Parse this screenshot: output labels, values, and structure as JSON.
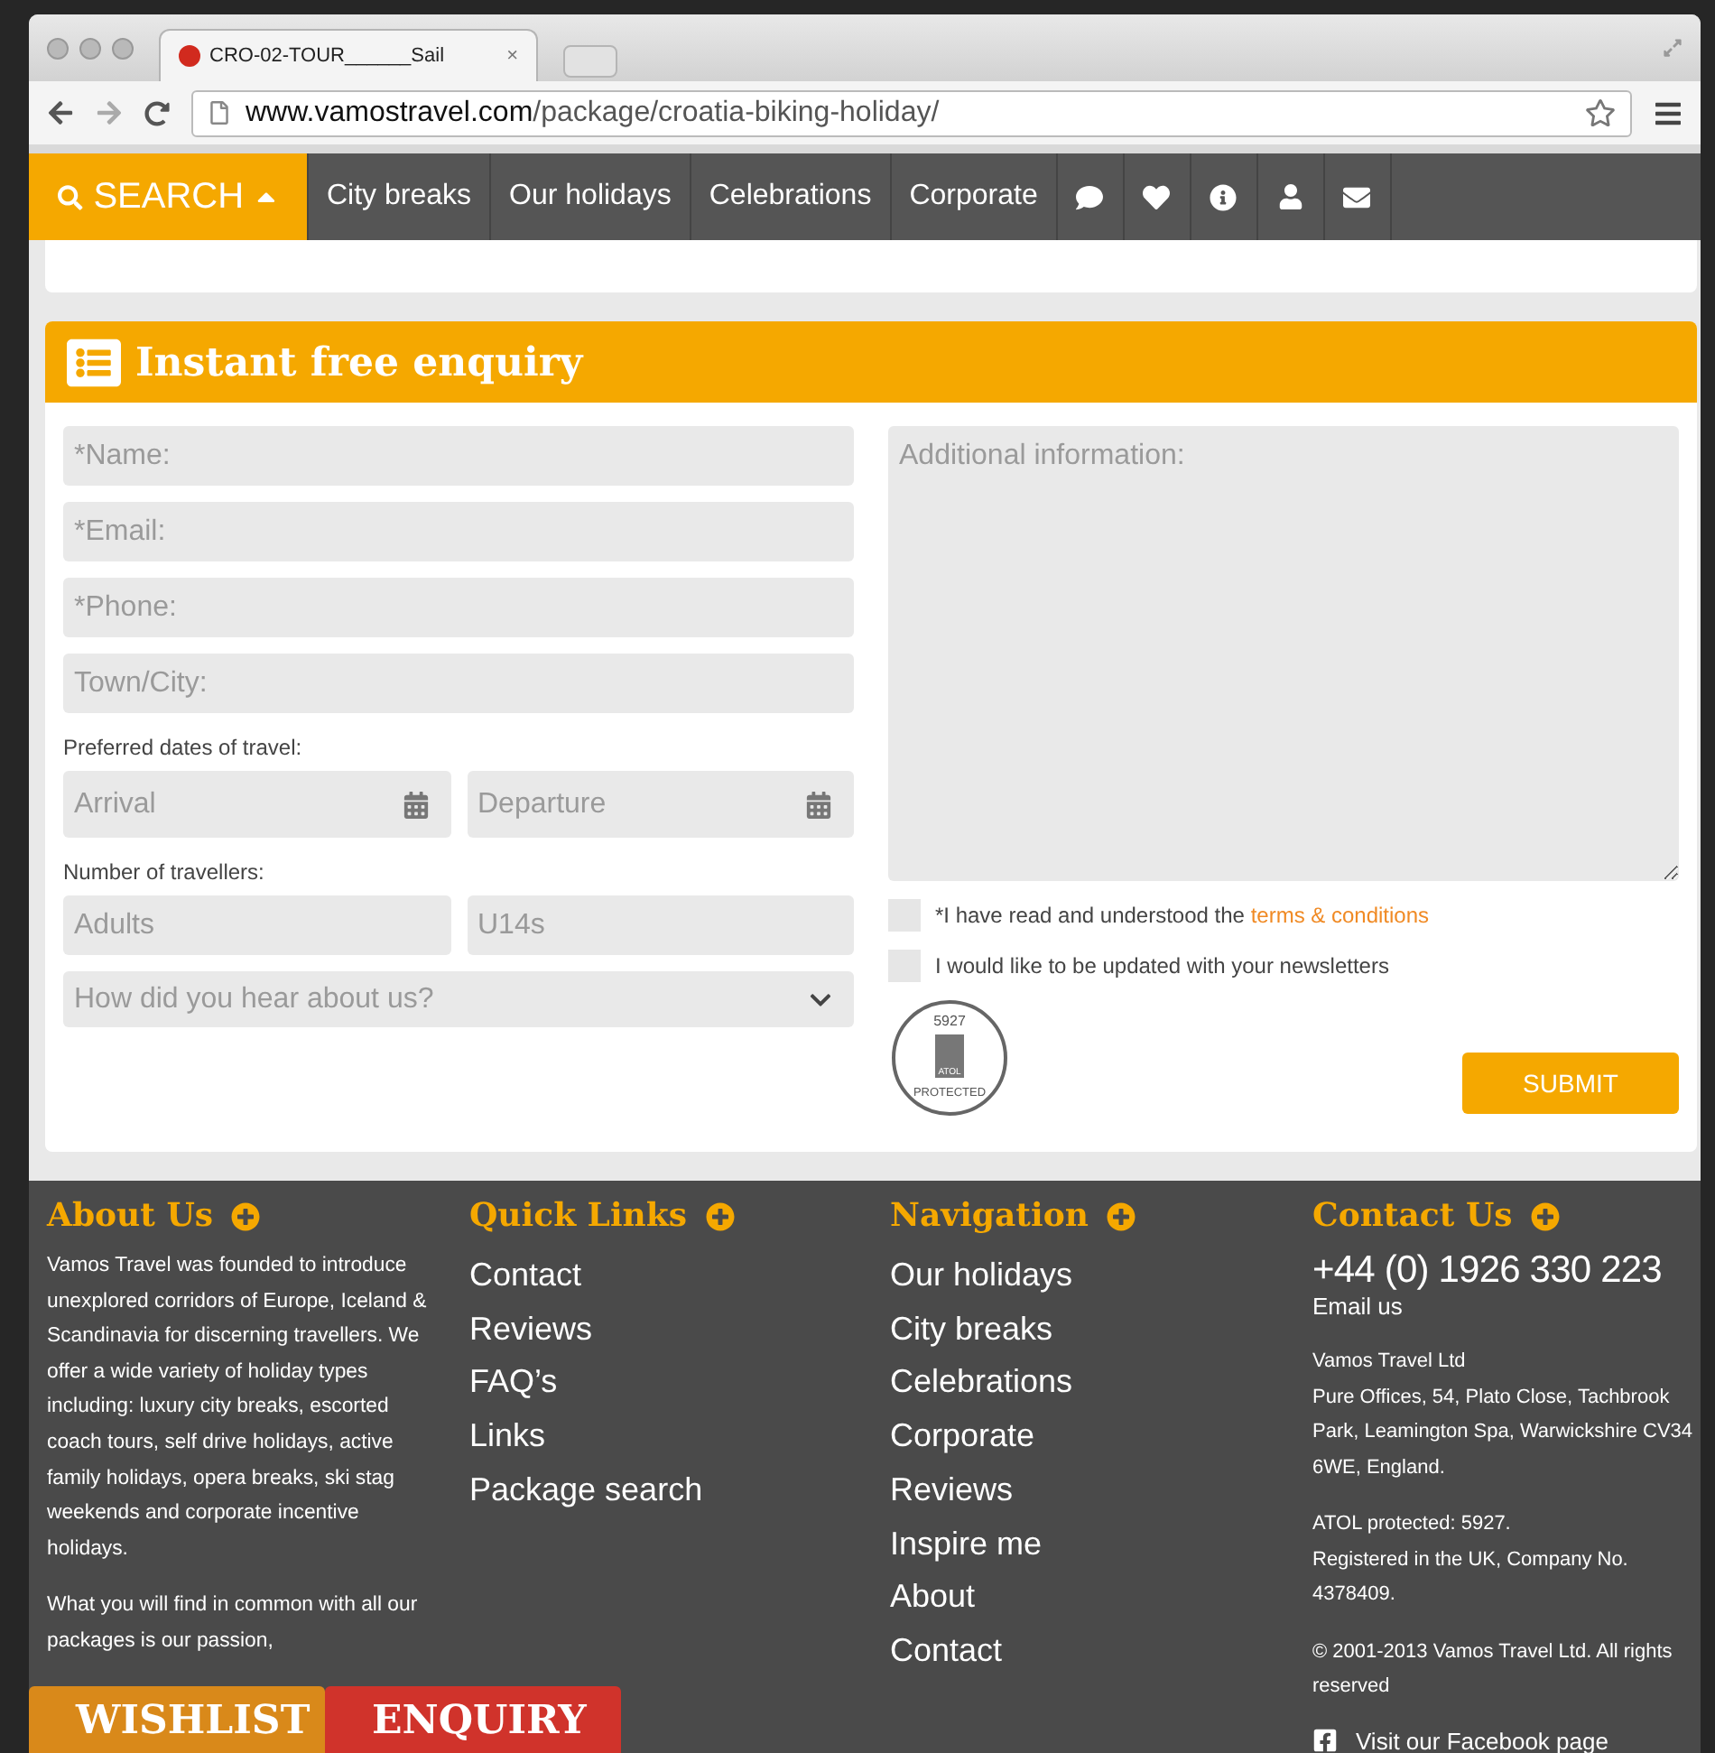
{
  "browser": {
    "tab_title": "CRO-02-TOUR______Sail",
    "tab_close": "×",
    "url_domain": "www.vamostravel.com",
    "url_path": "/package/croatia-biking-holiday/"
  },
  "nav": {
    "search_label": "SEARCH",
    "items": [
      "City breaks",
      "Our holidays",
      "Celebrations",
      "Corporate"
    ]
  },
  "enquiry": {
    "title": "Instant free enquiry",
    "left": [
      {
        "kind": "input",
        "placeholder": "*Name:"
      },
      {
        "kind": "input",
        "placeholder": "*Email:"
      },
      {
        "kind": "input",
        "placeholder": "*Phone:"
      },
      {
        "kind": "input",
        "placeholder": "Town/City:"
      },
      {
        "kind": "label",
        "text": "Preferred dates of travel:"
      },
      {
        "kind": "pair",
        "fields": [
          {
            "kind": "date",
            "placeholder": "Arrival"
          },
          {
            "kind": "date",
            "placeholder": "Departure"
          }
        ]
      },
      {
        "kind": "label",
        "text": "Number of travellers:"
      },
      {
        "kind": "pair",
        "fields": [
          {
            "kind": "number",
            "placeholder": "Adults"
          },
          {
            "kind": "number",
            "placeholder": "U14s"
          }
        ]
      },
      {
        "kind": "select",
        "placeholder": "How did you hear about us?"
      }
    ],
    "textarea_placeholder": "Additional information:",
    "checkboxes": [
      {
        "text": "*I have read and understood the",
        "link": "terms & conditions",
        "checked": false
      },
      {
        "text": "I would like to be updated with your newsletters",
        "checked": false
      }
    ],
    "badge": {
      "number": "5927",
      "brand": "ATOL",
      "caption": "PROTECTED"
    },
    "submit": "SUBMIT"
  },
  "footer": {
    "columns": [
      {
        "kind": "text",
        "title": "About Us",
        "paragraphs": [
          "Vamos Travel was founded to introduce unexplored corridors of Europe, Iceland & Scandinavia for discerning travellers. We offer a wide variety of holiday types including: luxury city breaks, escorted coach tours, self drive holidays, active family holidays, opera breaks, ski stag weekends and corporate incentive holidays.",
          "What you will find in common with all our packages is our passion,"
        ]
      },
      {
        "kind": "links",
        "title": "Quick Links",
        "links": [
          "Contact",
          "Reviews",
          "FAQ’s",
          "Links",
          "Package search"
        ]
      },
      {
        "kind": "links",
        "title": "Navigation",
        "links": [
          "Our holidays",
          "City breaks",
          "Celebrations",
          "Corporate",
          "Reviews",
          "Inspire me",
          "About",
          "Contact"
        ]
      },
      {
        "kind": "contact",
        "title": "Contact Us",
        "phone": "+44 (0) 1926 330 223",
        "email": "Email us",
        "blocks": [
          [
            "Vamos Travel Ltd",
            "Pure Offices, 54, Plato Close, Tachbrook Park, Leamington Spa, Warwickshire CV34 6WE, England."
          ],
          [
            "ATOL protected: 5927.",
            "Registered in the UK, Company No. 4378409."
          ],
          [
            "© 2001-2013 Vamos Travel Ltd. All rights reserved"
          ]
        ],
        "facebook": "Visit our Facebook page"
      }
    ]
  },
  "bottom_tabs": [
    {
      "label": "WISHLIST",
      "color": "#d9891a"
    },
    {
      "label": "ENQUIRY",
      "color": "#d0332b"
    }
  ]
}
